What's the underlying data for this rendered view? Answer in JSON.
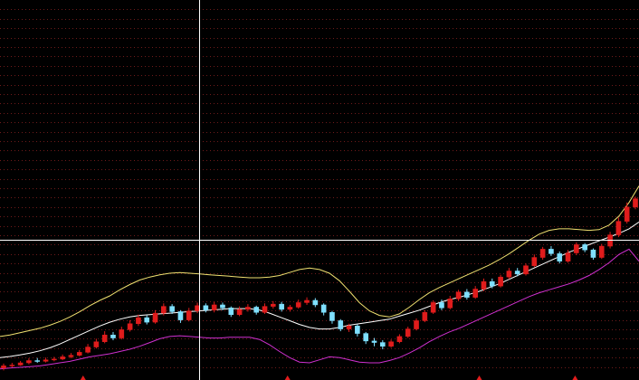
{
  "colors": {
    "background": "#000000",
    "grid": "#6e1a1a",
    "crosshair": "#ffffff",
    "up_candle": "#e01c1c",
    "down_candle": "#7fe0ff",
    "band_upper": "#f0e070",
    "band_middle": "#ffffff",
    "band_lower": "#d030d0",
    "marker": "#e01c1c"
  },
  "chart_data": {
    "type": "line",
    "title": "",
    "xlabel": "",
    "ylabel": "",
    "ylim": [
      0,
      100
    ],
    "grid": true,
    "candles": [
      [
        2.2,
        2.8,
        1.6,
        3.4
      ],
      [
        2.8,
        3.0,
        2.4,
        3.6
      ],
      [
        3.0,
        3.6,
        2.8,
        4.1
      ],
      [
        3.6,
        4.2,
        3.2,
        4.8
      ],
      [
        4.2,
        4.0,
        3.6,
        4.9
      ],
      [
        4.0,
        4.4,
        3.7,
        5.0
      ],
      [
        4.4,
        4.6,
        4.0,
        5.2
      ],
      [
        4.6,
        5.2,
        4.3,
        5.8
      ],
      [
        5.2,
        5.6,
        4.8,
        6.2
      ],
      [
        5.6,
        6.4,
        5.3,
        7.0
      ],
      [
        6.4,
        7.8,
        6.1,
        8.6
      ],
      [
        7.8,
        9.2,
        7.4,
        10.0
      ],
      [
        9.2,
        11.0,
        8.8,
        12.0
      ],
      [
        11.0,
        10.2,
        9.6,
        11.8
      ],
      [
        10.2,
        12.4,
        9.8,
        13.2
      ],
      [
        12.4,
        14.0,
        11.9,
        14.9
      ],
      [
        14.0,
        15.6,
        13.4,
        16.4
      ],
      [
        15.6,
        14.4,
        13.8,
        16.2
      ],
      [
        14.4,
        16.8,
        14.0,
        17.6
      ],
      [
        16.8,
        18.6,
        16.2,
        19.4
      ],
      [
        18.6,
        17.2,
        16.6,
        19.2
      ],
      [
        17.2,
        15.0,
        14.2,
        17.6
      ],
      [
        15.0,
        17.4,
        14.6,
        18.2
      ],
      [
        17.4,
        18.8,
        16.8,
        19.6
      ],
      [
        18.8,
        17.6,
        17.0,
        19.4
      ],
      [
        17.6,
        19.0,
        17.0,
        19.8
      ],
      [
        19.0,
        18.2,
        17.6,
        19.6
      ],
      [
        18.2,
        16.4,
        15.8,
        18.6
      ],
      [
        16.4,
        17.8,
        16.0,
        18.6
      ],
      [
        17.8,
        18.4,
        17.2,
        19.2
      ],
      [
        18.4,
        17.0,
        16.4,
        18.8
      ],
      [
        17.0,
        18.6,
        16.6,
        19.4
      ],
      [
        18.6,
        19.2,
        18.0,
        20.0
      ],
      [
        19.2,
        17.8,
        17.2,
        19.8
      ],
      [
        17.8,
        18.4,
        17.2,
        19.0
      ],
      [
        18.4,
        19.6,
        18.0,
        20.4
      ],
      [
        19.6,
        20.2,
        19.0,
        21.0
      ],
      [
        20.2,
        19.0,
        18.4,
        20.8
      ],
      [
        19.0,
        17.0,
        16.2,
        19.4
      ],
      [
        17.0,
        14.8,
        14.0,
        17.4
      ],
      [
        14.8,
        12.6,
        12.0,
        15.2
      ],
      [
        12.6,
        13.4,
        11.8,
        14.0
      ],
      [
        13.4,
        11.4,
        10.6,
        13.8
      ],
      [
        11.4,
        9.4,
        8.6,
        11.8
      ],
      [
        9.4,
        9.0,
        8.0,
        10.2
      ],
      [
        9.0,
        8.0,
        7.2,
        9.6
      ],
      [
        8.0,
        9.2,
        7.6,
        9.8
      ],
      [
        9.2,
        10.6,
        8.8,
        11.2
      ],
      [
        10.6,
        12.6,
        10.2,
        13.2
      ],
      [
        12.6,
        14.8,
        12.2,
        15.4
      ],
      [
        14.8,
        17.0,
        14.4,
        17.6
      ],
      [
        17.0,
        19.6,
        16.6,
        20.2
      ],
      [
        19.6,
        18.2,
        17.6,
        20.4
      ],
      [
        18.2,
        20.6,
        17.8,
        21.4
      ],
      [
        20.6,
        22.4,
        20.0,
        23.0
      ],
      [
        22.4,
        21.0,
        20.4,
        23.2
      ],
      [
        21.0,
        23.2,
        20.6,
        24.0
      ],
      [
        23.2,
        25.2,
        22.6,
        26.0
      ],
      [
        25.2,
        24.0,
        23.4,
        26.0
      ],
      [
        24.0,
        26.4,
        23.6,
        27.0
      ],
      [
        26.4,
        28.0,
        25.8,
        28.8
      ],
      [
        28.0,
        27.2,
        26.6,
        28.8
      ],
      [
        27.2,
        29.4,
        26.8,
        30.0
      ],
      [
        29.4,
        31.6,
        29.0,
        32.4
      ],
      [
        31.6,
        33.8,
        31.0,
        34.4
      ],
      [
        33.8,
        32.6,
        32.0,
        34.6
      ],
      [
        32.6,
        30.6,
        30.0,
        33.2
      ],
      [
        30.6,
        32.8,
        30.2,
        33.6
      ],
      [
        32.8,
        35.0,
        32.2,
        35.6
      ],
      [
        35.0,
        33.6,
        33.0,
        35.4
      ],
      [
        33.6,
        31.6,
        31.0,
        34.0
      ],
      [
        31.6,
        34.6,
        31.2,
        35.2
      ],
      [
        34.6,
        37.6,
        34.0,
        38.4
      ],
      [
        37.6,
        41.2,
        37.0,
        42.2
      ],
      [
        41.2,
        45.0,
        40.6,
        46.2
      ],
      [
        45.0,
        47.2,
        44.4,
        47.8
      ]
    ],
    "series": [
      {
        "values": [
          10.6,
          11.0,
          11.6,
          12.2,
          12.8,
          13.6,
          14.6,
          15.8,
          17.2,
          18.8,
          20.2,
          21.4,
          23.0,
          24.4,
          25.6,
          26.4,
          27.0,
          27.4,
          27.6,
          27.4,
          27.2,
          27.0,
          26.8,
          26.6,
          26.4,
          26.2,
          26.2,
          26.4,
          26.8,
          27.6,
          28.4,
          28.8,
          28.4,
          27.4,
          25.4,
          22.6,
          19.6,
          17.4,
          16.2,
          15.8,
          16.6,
          18.4,
          20.4,
          22.2,
          23.6,
          24.8,
          26.0,
          27.2,
          28.4,
          29.6,
          31.0,
          32.6,
          34.4,
          36.2,
          37.8,
          38.8,
          39.2,
          39.2,
          39.0,
          38.8,
          39.0,
          40.2,
          42.6,
          46.2,
          50.6
        ]
      },
      {
        "values": [
          5.0,
          5.3,
          5.7,
          6.2,
          6.8,
          7.6,
          8.6,
          9.8,
          11.0,
          12.2,
          13.4,
          14.4,
          15.2,
          15.8,
          16.2,
          16.4,
          16.6,
          16.8,
          17.0,
          17.2,
          17.4,
          17.6,
          17.8,
          18.0,
          18.0,
          18.0,
          17.6,
          16.8,
          15.8,
          14.8,
          13.8,
          13.0,
          12.6,
          12.6,
          13.0,
          13.6,
          14.0,
          14.4,
          14.8,
          15.2,
          16.0,
          16.8,
          17.6,
          18.6,
          19.6,
          20.4,
          21.0,
          21.8,
          22.6,
          23.6,
          24.6,
          25.8,
          27.0,
          28.2,
          29.4,
          30.6,
          31.8,
          33.0,
          34.0,
          35.0,
          36.0,
          37.0,
          38.0,
          39.2,
          41.0
        ]
      },
      {
        "values": [
          2.0,
          2.2,
          2.4,
          2.6,
          2.8,
          3.2,
          3.6,
          4.0,
          4.6,
          5.2,
          5.6,
          6.0,
          6.6,
          7.2,
          8.0,
          9.0,
          10.0,
          10.6,
          10.8,
          10.6,
          10.4,
          10.2,
          10.2,
          10.4,
          10.4,
          10.4,
          9.8,
          8.4,
          6.6,
          5.0,
          3.8,
          3.6,
          4.4,
          5.2,
          5.0,
          4.4,
          3.8,
          3.6,
          3.6,
          4.2,
          5.0,
          6.2,
          7.6,
          9.2,
          10.6,
          11.8,
          12.8,
          14.0,
          15.2,
          16.4,
          17.6,
          18.8,
          20.0,
          21.2,
          22.2,
          23.0,
          23.8,
          24.6,
          25.6,
          26.8,
          28.4,
          30.2,
          32.4,
          33.8,
          30.6
        ]
      }
    ],
    "crosshair": {
      "x": 0.3116,
      "y": 0.6321
    },
    "markers": [
      13,
      45,
      75,
      90
    ]
  }
}
